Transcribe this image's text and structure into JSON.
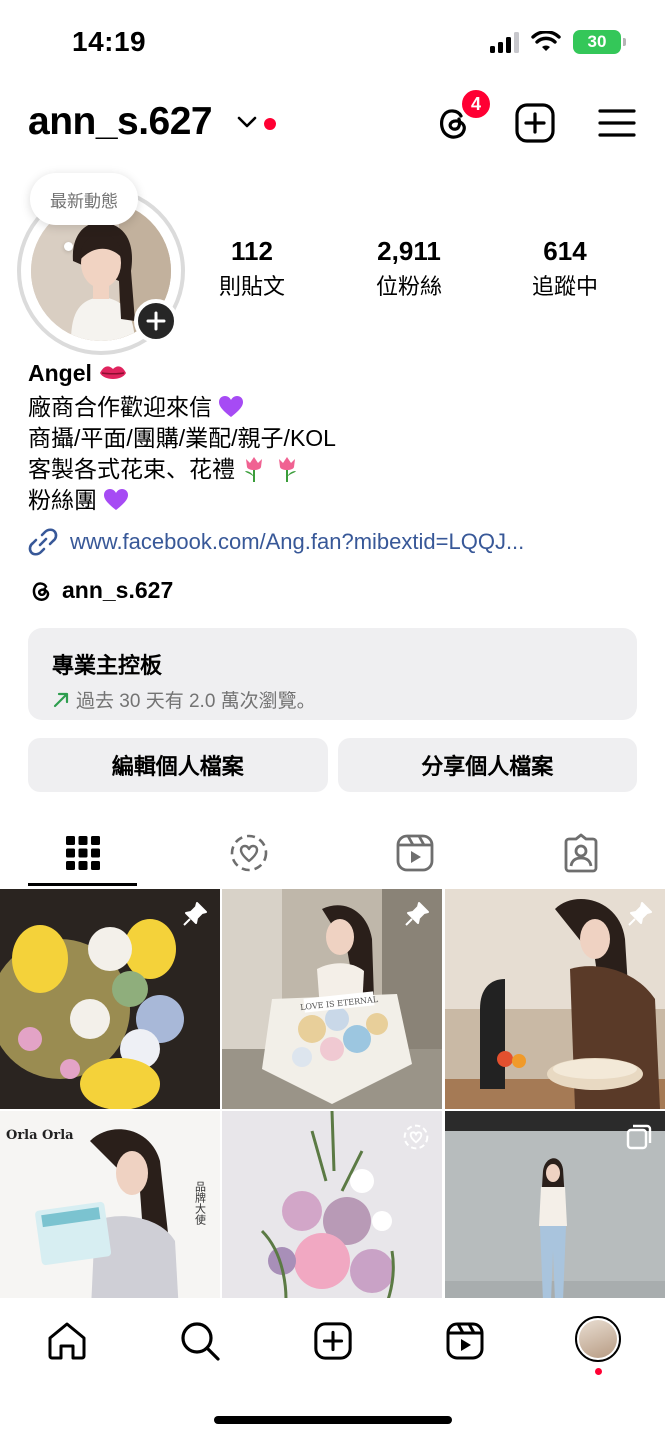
{
  "status_bar": {
    "time": "14:19",
    "battery": "30"
  },
  "header": {
    "username": "ann_s.627",
    "notification_count": "4"
  },
  "profile": {
    "note": "最新動態",
    "stats": [
      {
        "value": "112",
        "label": "則貼文"
      },
      {
        "value": "2,911",
        "label": "位粉絲"
      },
      {
        "value": "614",
        "label": "追蹤中"
      }
    ]
  },
  "bio": {
    "name": "Angel",
    "lines": [
      "廠商合作歡迎來信",
      "商攝/平面/團購/業配/親子/KOL",
      "客製各式花束、花禮",
      "粉絲團"
    ],
    "link": "www.facebook.com/Ang.fan?mibextid=LQQJ...",
    "threads_handle": "ann_s.627"
  },
  "dashboard": {
    "title": "專業主控板",
    "subtitle": "過去 30 天有 2.0 萬次瀏覽。"
  },
  "buttons": {
    "edit": "編輯個人檔案",
    "share": "分享個人檔案"
  },
  "grid_overlay_text": {
    "brand": "Orla Orla",
    "ambassador": "品牌大使",
    "bouquet": "LOVE IS ETERNAL"
  },
  "colors": {
    "accent": "#ff0033",
    "link": "#385898",
    "button_bg": "#efeff1",
    "heart": "#a64bf4",
    "battery": "#34c759"
  },
  "icons": {
    "header": [
      "chevron-down-icon",
      "threads-icon",
      "add-post-icon",
      "menu-icon"
    ],
    "tabs": [
      "grid-icon",
      "collab-heart-icon",
      "reels-icon",
      "tagged-icon"
    ],
    "nav": [
      "home-icon",
      "search-icon",
      "create-icon",
      "reels-icon",
      "profile-avatar"
    ]
  }
}
